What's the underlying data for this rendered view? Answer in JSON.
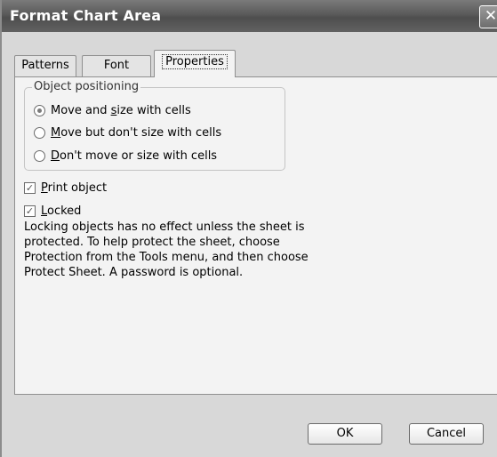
{
  "window": {
    "title": "Format Chart Area",
    "close_label": "✕"
  },
  "tabs": [
    {
      "label": "Patterns"
    },
    {
      "label": "Font"
    },
    {
      "label": "Properties"
    }
  ],
  "positioning": {
    "legend": "Object positioning",
    "options": [
      {
        "pre": "Move and ",
        "accel": "s",
        "post": "ize with cells",
        "selected": true
      },
      {
        "pre": "",
        "accel": "M",
        "post": "ove but don't size with cells",
        "selected": false
      },
      {
        "pre": "",
        "accel": "D",
        "post": "on't move or size with cells",
        "selected": false
      }
    ]
  },
  "print_object": {
    "accel": "P",
    "post": "rint object",
    "checked": true
  },
  "locked": {
    "accel": "L",
    "post": "ocked",
    "checked": true
  },
  "note_lines": [
    "Locking objects has no effect unless the sheet is",
    "protected.  To help protect the sheet, choose",
    "Protection from the Tools menu, and then choose",
    "Protect Sheet.  A password is optional."
  ],
  "buttons": {
    "ok": "OK",
    "cancel": "Cancel"
  }
}
